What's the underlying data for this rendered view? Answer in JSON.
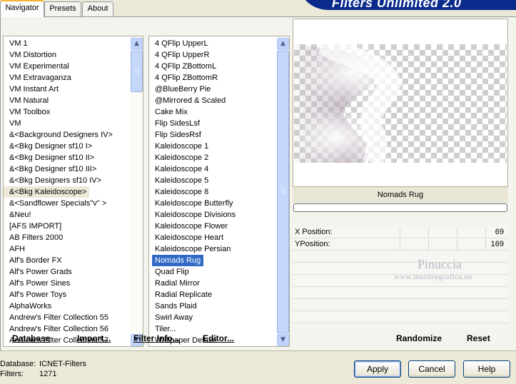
{
  "app": {
    "title": "Filters Unlimited 2.0"
  },
  "tabs": [
    {
      "label": "Navigator",
      "active": true
    },
    {
      "label": "Presets",
      "active": false
    },
    {
      "label": "About",
      "active": false
    }
  ],
  "categories": {
    "items": [
      "VM 1",
      "VM Distortion",
      "VM Experimental",
      "VM Extravaganza",
      "VM Instant Art",
      "VM Natural",
      "VM Toolbox",
      "VM",
      "&<Background Designers IV>",
      "&<Bkg Designer sf10 I>",
      "&<Bkg Designer sf10 II>",
      "&<Bkg Designer sf10 III>",
      "&<Bkg Designers sf10 IV>",
      "&<Bkg Kaleidoscope>",
      "&<Sandflower Specials\"v\" >",
      "&Neu!",
      "[AFS IMPORT]",
      "AB Filters 2000",
      "AFH",
      "Alf's Border FX",
      "Alf's Power Grads",
      "Alf's Power Sines",
      "Alf's Power Toys",
      "AlphaWorks",
      "Andrew's Filter Collection 55",
      "Andrew's Filter Collection 56",
      "Andrew's Filter Collection 57"
    ],
    "selected_index": 13
  },
  "filters": {
    "items": [
      "4 QFlip UpperL",
      "4 QFlip UpperR",
      "4 QFlip ZBottomL",
      "4 QFlip ZBottomR",
      "@BlueBerry Pie",
      "@Mirrored & Scaled",
      "Cake Mix",
      "Flip SidesLsf",
      "Flip SidesRsf",
      "Kaleidoscope 1",
      "Kaleidoscope 2",
      "Kaleidoscope 4",
      "Kaleidoscope 5",
      "Kaleidoscope 8",
      "Kaleidoscope Butterfly",
      "Kaleidoscope Divisions",
      "Kaleidoscope Flower",
      "Kaleidoscope Heart",
      "Kaleidoscope Persian",
      "Nomads Rug",
      "Quad Flip",
      "Radial Mirror",
      "Radial Replicate",
      "Sands Plaid",
      "Swirl Away",
      "Tiler...",
      "Wallpaper Deluxe"
    ],
    "selected_index": 19
  },
  "commands": {
    "database": "Database",
    "import": "Import...",
    "filter_info": "Filter Info...",
    "editor": "Editor...",
    "randomize": "Randomize",
    "reset": "Reset"
  },
  "preview": {
    "filter_name": "Nomads Rug"
  },
  "params": [
    {
      "label": "X Position:",
      "value": "69"
    },
    {
      "label": "YPosition:",
      "value": "169"
    }
  ],
  "watermark": {
    "name": "Pinuccia",
    "url": "www.maidiregrafica.eu"
  },
  "status": {
    "database_label": "Database:",
    "database_value": "ICNET-Filters",
    "filters_label": "Filters:",
    "filters_value": "1271"
  },
  "buttons": {
    "apply": "Apply",
    "cancel": "Cancel",
    "help": "Help"
  },
  "colors": {
    "banner": "#0a2a8c",
    "selection": "#316ac5",
    "tab_accent": "#f7b432"
  },
  "icons": {
    "scroll_up": "▲",
    "scroll_down": "▼"
  }
}
